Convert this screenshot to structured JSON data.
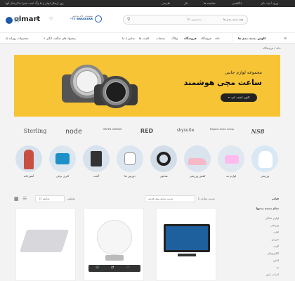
{
  "topbar": {
    "promo": "روز ارسال اوتار و ما وگ است شیرا ما ارسال آنها",
    "links": [
      "ورود / ثبت نام",
      "انگلیسی",
      "مقایسه ها",
      "دلار"
    ],
    "lang": "فارسی"
  },
  "header": {
    "logo": "olmart",
    "search_category": "همه دسته بندی ها",
    "search_placeholder": "جستجوی کالا...",
    "phone_label": "پشتیبانی 24 ساعته",
    "phone": "۰۲۱-۸۸۸۸۸۸۸۸",
    "cart_label": "سبد خرید",
    "compare_label": "مقایسه",
    "wishlist_label": "علاقه مندی"
  },
  "nav": {
    "categories": "کاوش دسته بندی ها",
    "items": [
      "خانه",
      "فروشگاه",
      "فروشگاه",
      "وبلاگ",
      "صفحات",
      "المنت ها",
      "تماس با ما"
    ],
    "offer": "پیشنهاد های شگفت انگیز",
    "recent": "محصولات روزانه"
  },
  "breadcrumb": "خانه / فروشگاه",
  "banner": {
    "subtitle": "مجموعه لوازم جانبی",
    "title": "ساعت مچی هوشمند",
    "button": "اکنون کشف کنید"
  },
  "brands": [
    "NS8",
    "Elegant Asian Group",
    "skysuite",
    "RED",
    "GREEN GARAGE",
    "node",
    "Sterling"
  ],
  "categories": [
    "ورزشی",
    "لوازم مد",
    "کفش ورزشی",
    "هدفون",
    "دوربین ها",
    "گجت",
    "کتری برقی",
    "آشپزخانه",
    "ساعت",
    "لباس ها"
  ],
  "toolbar": {
    "filter": "فیلتر",
    "sort_label": "مرتب سازی با",
    "sort_value": "مرتب سازی پیش فرض",
    "show_label": "نمایش",
    "show_value": "12 نمایش",
    "view_label": "نمای"
  },
  "sidebar": {
    "title": "تمام دسته بندیها",
    "items": [
      "لوازم خانگی",
      "ورزشی",
      "کتاب",
      "دوربین",
      "گجت",
      "الکترونیکی",
      "لباس",
      "مد",
      "اسباب بازی"
    ]
  },
  "colors": {
    "accent": "#f7c435",
    "dark": "#2a2a2a",
    "primary": "#1e5aa8"
  }
}
